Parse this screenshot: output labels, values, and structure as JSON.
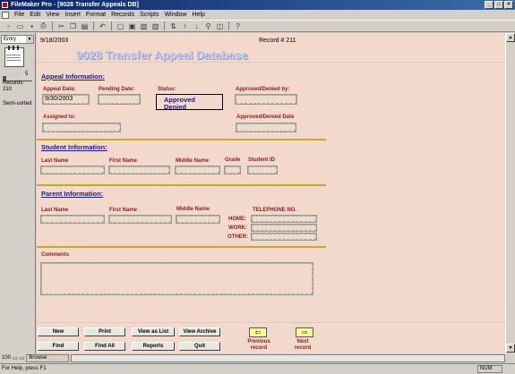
{
  "window": {
    "title": "FileMaker Pro - [9028 Transfer Appeals DB]"
  },
  "menu": [
    "File",
    "Edit",
    "View",
    "Insert",
    "Format",
    "Records",
    "Scripts",
    "Window",
    "Help"
  ],
  "sidebar": {
    "layout": "Entry",
    "record_number": "5",
    "records_label": "Records:",
    "records_total": "210",
    "sort_state": "Semi-sorted"
  },
  "header": {
    "date": "9/18/2003",
    "record_label": "Record # 211",
    "db_title": "9028 Transfer Appeal Database"
  },
  "appeal": {
    "section_title": "Appeal Information:",
    "appeal_date_label": "Appeal Date:",
    "appeal_date_value": "9/30/2003",
    "pending_date_label": "Pending Date:",
    "status_label": "Status:",
    "status_options": [
      "Approved",
      "Denied"
    ],
    "approved_by_label": "Approved/Denied by:",
    "assigned_to_label": "Assigned to:",
    "approved_date_label": "Approved/Denied Date"
  },
  "student": {
    "section_title": "Student Information:",
    "last_name": "Last Name",
    "first_name": "First Name",
    "middle_name": "Middle Name",
    "grade": "Grade",
    "student_id": "Student ID"
  },
  "parent": {
    "section_title": "Parent Information:",
    "last_name": "Last Name",
    "first_name": "First Name",
    "middle_name": "Middle Name",
    "telephone": "TELEPHONE NO.",
    "home": "HOME:",
    "work": "WORK:",
    "other": "OTHER:"
  },
  "comments": {
    "label": "Comments"
  },
  "buttons": {
    "new": "New",
    "print": "Print",
    "view_as_list": "View as List",
    "view_archive": "View Archive",
    "find": "Find",
    "find_all": "Find All",
    "reports": "Reports",
    "quit": "Quit",
    "previous": "Previous record",
    "next": "Next record"
  },
  "status": {
    "zoom": "100",
    "mode": "Browse",
    "help": "For Help, press F1",
    "num": "NUM"
  },
  "colors": {
    "background": "#f3d9cc",
    "title_blue": "#1a1a8c",
    "label_red": "#8b1a1a",
    "divider": "#c8a828"
  }
}
